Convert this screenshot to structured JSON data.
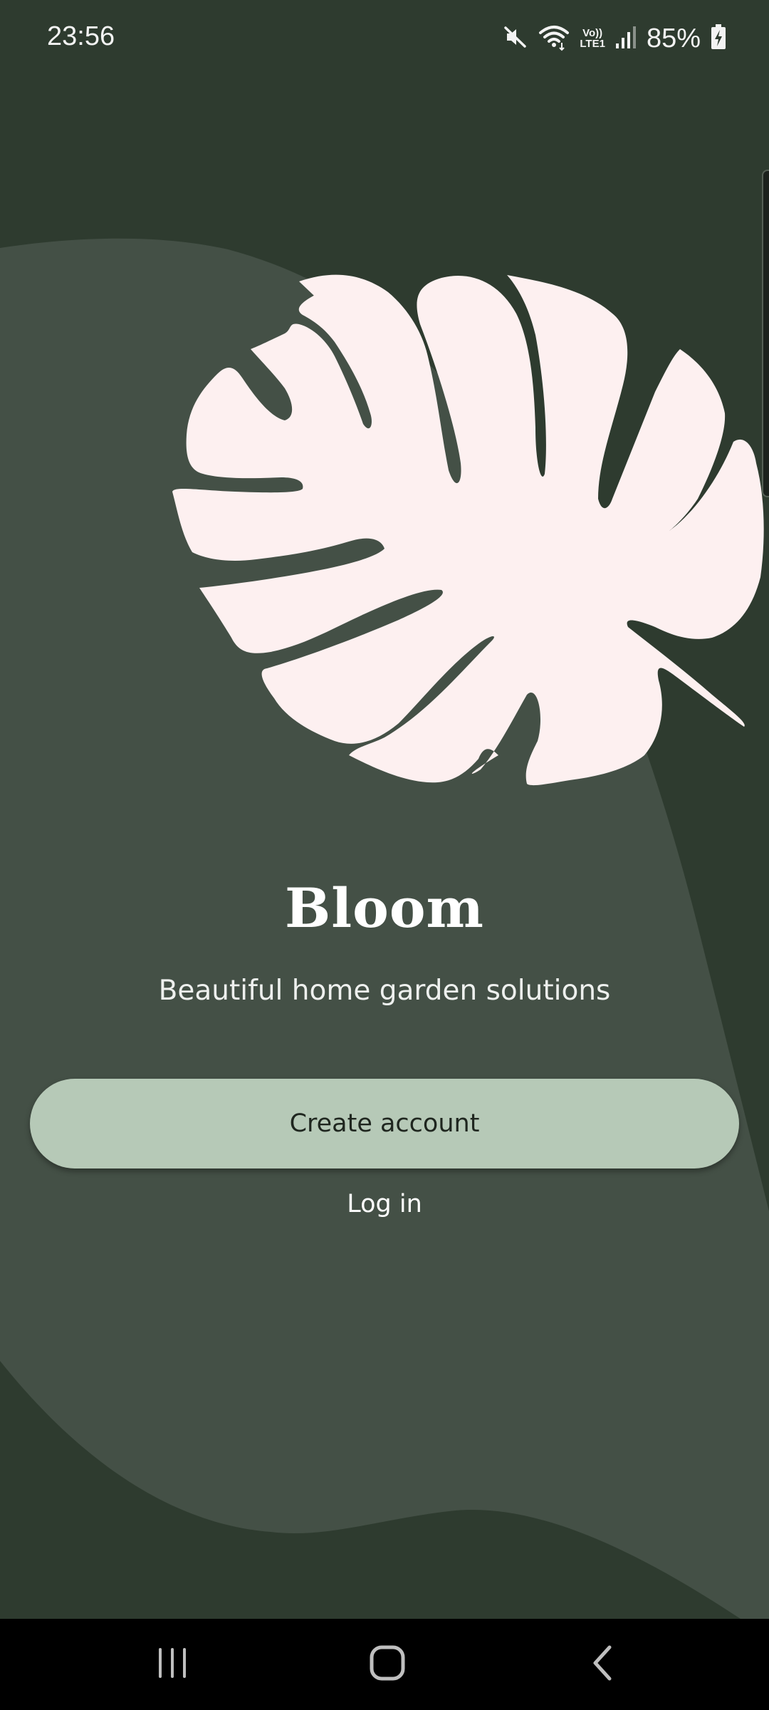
{
  "status_bar": {
    "time": "23:56",
    "battery_percent": "85%",
    "network_label_top": "Vo))",
    "network_label_bottom": "LTE1",
    "icons": [
      "mute-icon",
      "wifi-icon",
      "volte-icon",
      "signal-icon",
      "battery-charging-icon"
    ]
  },
  "app": {
    "title": "Bloom",
    "tagline": "Beautiful home garden solutions"
  },
  "actions": {
    "create_account_label": "Create account",
    "login_label": "Log in"
  },
  "nav_bar": {
    "icons": [
      "recent-apps-icon",
      "home-icon",
      "back-icon"
    ]
  },
  "colors": {
    "background_dark": "#2e3b2f",
    "background_shape": "#445046",
    "leaf": "#fdf0f0",
    "primary_button": "#b6c9b7",
    "text_light": "#ffffff"
  }
}
